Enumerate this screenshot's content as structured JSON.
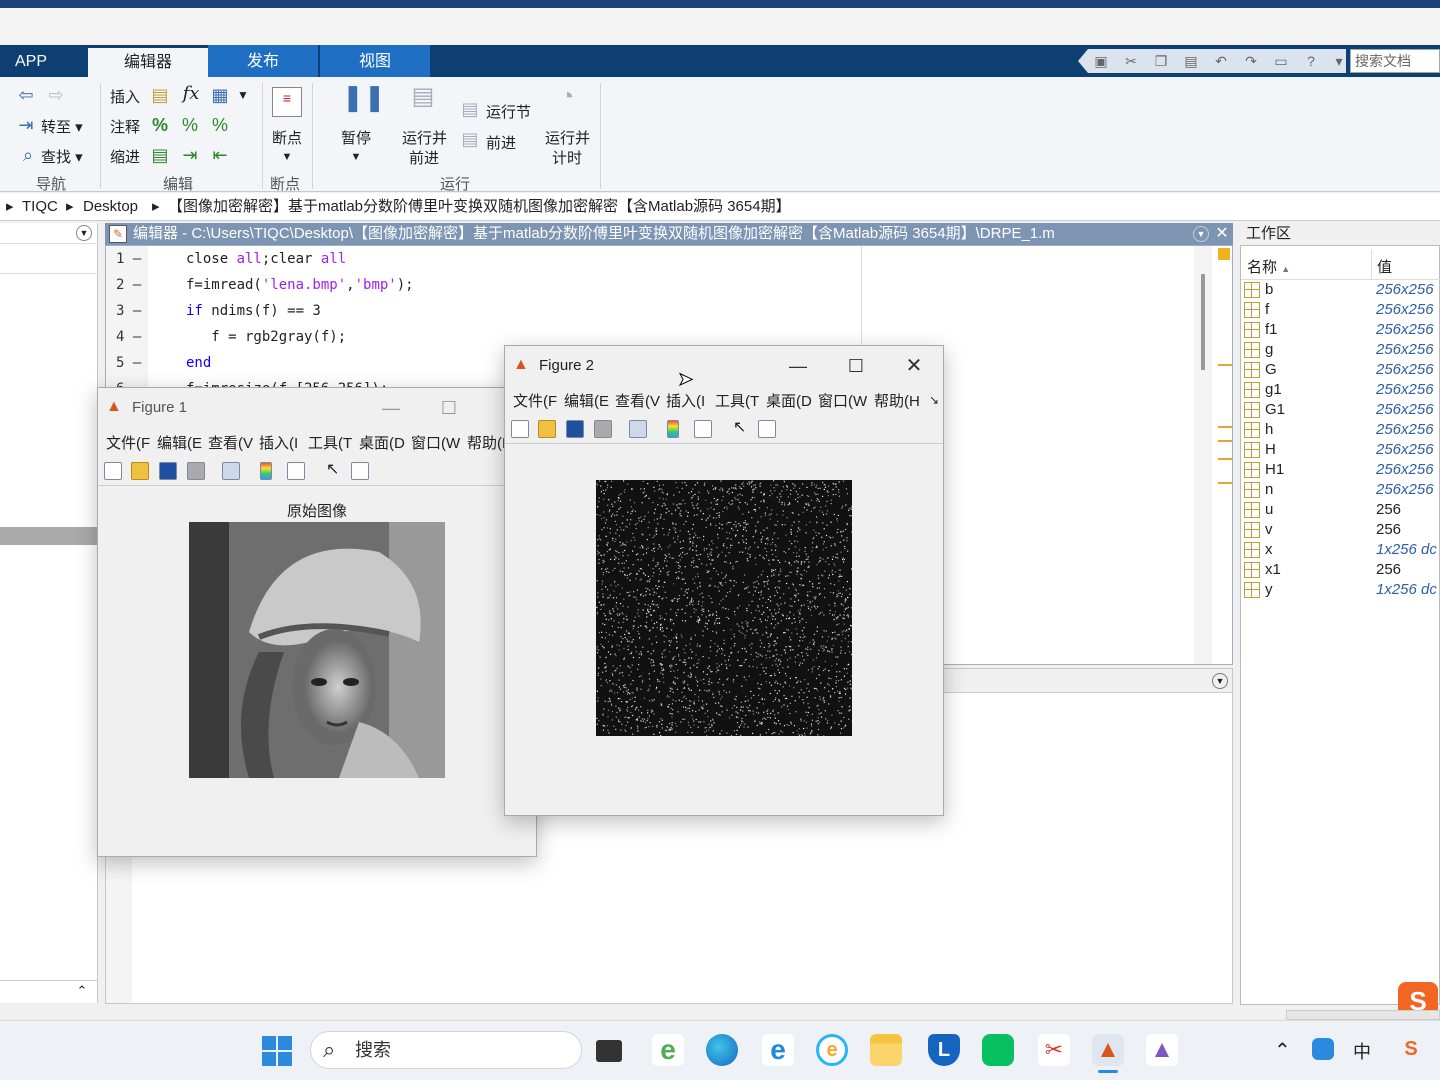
{
  "ribbon_tabs": [
    "APP",
    "编辑器",
    "发布",
    "视图"
  ],
  "search_doc_placeholder": "搜索文档",
  "ribbon": {
    "nav": {
      "goto": "转至",
      "find": "查找",
      "group": "导航"
    },
    "edit": {
      "insert": "插入",
      "comment": "注释",
      "indent": "缩进",
      "group": "编辑",
      "fx": "fx"
    },
    "breakpoint": {
      "label": "断点",
      "group": "断点"
    },
    "run": {
      "pause": "暂停",
      "run_advance_1": "运行并",
      "run_advance_2": "前进",
      "run_section": "运行节",
      "advance": "前进",
      "run_time_1": "运行并",
      "run_time_2": "计时",
      "group": "运行"
    }
  },
  "breadcrumb": [
    "TIQC",
    "Desktop",
    "【图像加密解密】基于matlab分数阶傅里叶变换双随机图像加密解密【含Matlab源码 3654期】"
  ],
  "editor": {
    "title": "编辑器 - C:\\Users\\TIQC\\Desktop\\【图像加密解密】基于matlab分数阶傅里叶变换双随机图像加密解密【含Matlab源码 3654期】\\DRPE_1.m",
    "lines": [
      {
        "n": "1",
        "code": "close all;clear all"
      },
      {
        "n": "2",
        "code": "f=imread('lena.bmp','bmp');"
      },
      {
        "n": "3",
        "code": "if ndims(f) == 3"
      },
      {
        "n": "4",
        "code": "   f = rgb2gray(f);"
      },
      {
        "n": "5",
        "code": "end"
      },
      {
        "n": "6",
        "code": "f=imresize(f,[256,256]);"
      }
    ]
  },
  "workspace": {
    "title": "工作区",
    "col_name": "名称",
    "col_value": "值",
    "vars": [
      {
        "name": "b",
        "value": "256x256",
        "italic": true
      },
      {
        "name": "f",
        "value": "256x256",
        "italic": true
      },
      {
        "name": "f1",
        "value": "256x256",
        "italic": true
      },
      {
        "name": "g",
        "value": "256x256",
        "italic": true
      },
      {
        "name": "G",
        "value": "256x256",
        "italic": true
      },
      {
        "name": "g1",
        "value": "256x256",
        "italic": true
      },
      {
        "name": "G1",
        "value": "256x256",
        "italic": true
      },
      {
        "name": "h",
        "value": "256x256",
        "italic": true
      },
      {
        "name": "H",
        "value": "256x256",
        "italic": true
      },
      {
        "name": "H1",
        "value": "256x256",
        "italic": true
      },
      {
        "name": "n",
        "value": "256x256",
        "italic": true
      },
      {
        "name": "u",
        "value": "256",
        "italic": false
      },
      {
        "name": "v",
        "value": "256",
        "italic": false
      },
      {
        "name": "x",
        "value": "1x256 dc",
        "italic": true
      },
      {
        "name": "x1",
        "value": "256",
        "italic": false
      },
      {
        "name": "y",
        "value": "1x256 dc",
        "italic": true
      }
    ]
  },
  "figure1": {
    "title": "Figure 1",
    "menu": [
      "文件(F",
      "编辑(E",
      "查看(V",
      "插入(I",
      "工具(T",
      "桌面(D",
      "窗口(W",
      "帮助(H"
    ],
    "axes_title": "原始图像"
  },
  "figure2": {
    "title": "Figure 2",
    "menu": [
      "文件(F",
      "编辑(E",
      "查看(V",
      "插入(I",
      "工具(T",
      "桌面(D",
      "窗口(W",
      "帮助(H"
    ]
  },
  "taskbar": {
    "search": "搜索",
    "ime": "中"
  }
}
